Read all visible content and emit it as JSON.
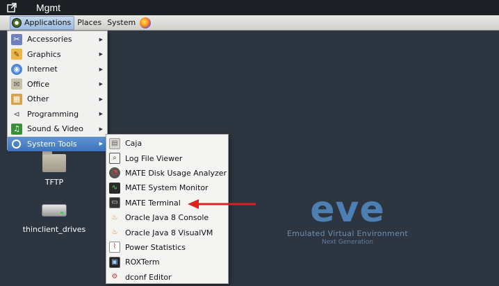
{
  "window": {
    "title": "Mgmt"
  },
  "panel": {
    "applications_label": "Applications",
    "places_label": "Places",
    "system_label": "System"
  },
  "menu": {
    "items": [
      {
        "label": "Accessories",
        "icon": "accessories-icon"
      },
      {
        "label": "Graphics",
        "icon": "graphics-icon"
      },
      {
        "label": "Internet",
        "icon": "internet-icon"
      },
      {
        "label": "Office",
        "icon": "office-icon"
      },
      {
        "label": "Other",
        "icon": "other-icon"
      },
      {
        "label": "Programming",
        "icon": "programming-icon"
      },
      {
        "label": "Sound & Video",
        "icon": "sound-video-icon"
      },
      {
        "label": "System Tools",
        "icon": "system-tools-icon",
        "selected": true
      }
    ]
  },
  "submenu": {
    "items": [
      {
        "label": "Caja",
        "icon": "caja-icon"
      },
      {
        "label": "Log File Viewer",
        "icon": "log-viewer-icon"
      },
      {
        "label": "MATE Disk Usage Analyzer",
        "icon": "disk-usage-icon"
      },
      {
        "label": "MATE System Monitor",
        "icon": "system-monitor-icon"
      },
      {
        "label": "MATE Terminal",
        "icon": "terminal-icon"
      },
      {
        "label": "Oracle Java 8 Console",
        "icon": "java-icon"
      },
      {
        "label": "Oracle Java 8 VisualVM",
        "icon": "java-visualvm-icon"
      },
      {
        "label": "Power Statistics",
        "icon": "power-stats-icon"
      },
      {
        "label": "ROXTerm",
        "icon": "roxterm-icon"
      },
      {
        "label": "dconf Editor",
        "icon": "dconf-icon"
      }
    ]
  },
  "desktop": {
    "icons": [
      {
        "label": "TFTP",
        "icon": "folder-icon"
      },
      {
        "label": "thinclient_drives",
        "icon": "drive-icon"
      }
    ]
  },
  "logo": {
    "word": "eve",
    "tagline": "Emulated Virtual Environment",
    "subtagline": "Next Generation"
  },
  "colors": {
    "desktop_bg": "#2d3540",
    "selection": "#3d74bd",
    "annotation_arrow": "#e0201c",
    "logo": "#4d7fb3"
  }
}
